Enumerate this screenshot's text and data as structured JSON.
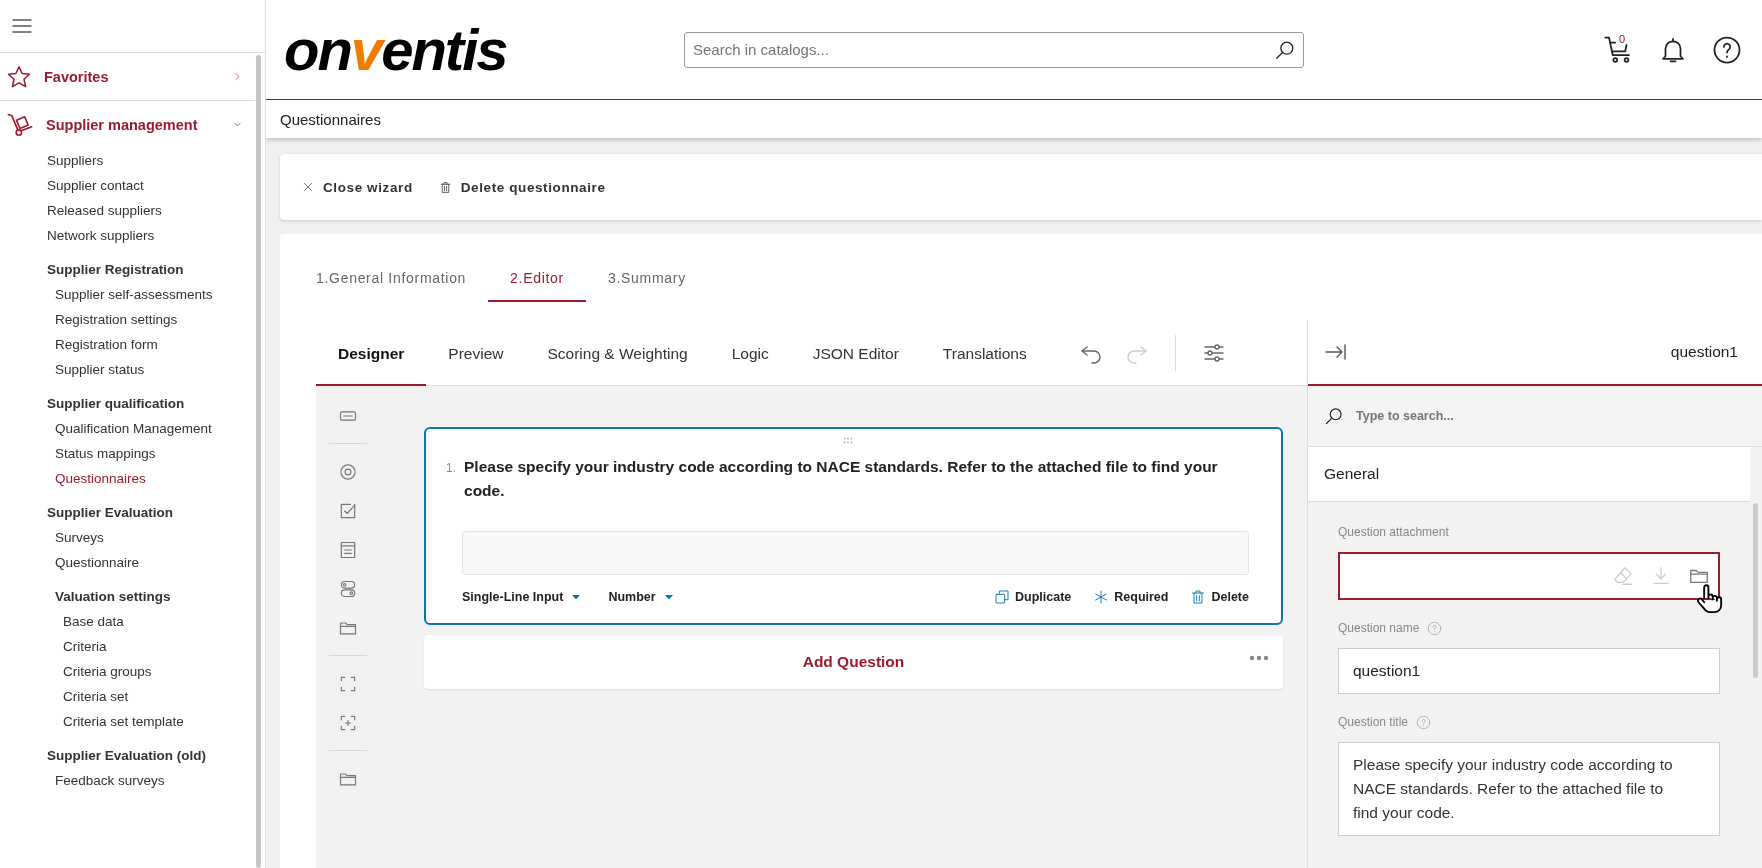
{
  "sidebar": {
    "items": [
      {
        "kind": "top",
        "label": "Favorites",
        "expanded": false
      },
      {
        "kind": "top",
        "label": "Supplier management",
        "expanded": true,
        "children": [
          {
            "kind": "link",
            "label": "Suppliers",
            "selected": false
          },
          {
            "kind": "link",
            "label": "Supplier contact",
            "selected": false
          },
          {
            "kind": "link",
            "label": "Released suppliers",
            "selected": false
          },
          {
            "kind": "link",
            "label": "Network suppliers",
            "selected": false
          },
          {
            "kind": "heading",
            "label": "Supplier Registration",
            "children": [
              {
                "kind": "link",
                "label": "Supplier self-assessments",
                "selected": false
              },
              {
                "kind": "link",
                "label": "Registration settings",
                "selected": false
              },
              {
                "kind": "link",
                "label": "Registration form",
                "selected": false
              },
              {
                "kind": "link",
                "label": "Supplier status",
                "selected": false
              }
            ]
          },
          {
            "kind": "heading",
            "label": "Supplier qualification",
            "children": [
              {
                "kind": "link",
                "label": "Qualification Management",
                "selected": false
              },
              {
                "kind": "link",
                "label": "Status mappings",
                "selected": false
              },
              {
                "kind": "link",
                "label": "Questionnaires",
                "selected": true
              }
            ]
          },
          {
            "kind": "heading",
            "label": "Supplier Evaluation",
            "children": [
              {
                "kind": "link",
                "label": "Surveys",
                "selected": false
              },
              {
                "kind": "link",
                "label": "Questionnaire",
                "selected": false
              },
              {
                "kind": "heading",
                "label": "Valuation settings",
                "children": [
                  {
                    "kind": "link",
                    "label": "Base data",
                    "selected": false
                  },
                  {
                    "kind": "link",
                    "label": "Criteria",
                    "selected": false
                  },
                  {
                    "kind": "link",
                    "label": "Criteria groups",
                    "selected": false
                  },
                  {
                    "kind": "link",
                    "label": "Criteria set",
                    "selected": false
                  },
                  {
                    "kind": "link",
                    "label": "Criteria set template",
                    "selected": false
                  }
                ]
              }
            ]
          },
          {
            "kind": "heading",
            "label": "Supplier Evaluation (old)",
            "children": [
              {
                "kind": "link",
                "label": "Feedback surveys",
                "selected": false
              }
            ]
          }
        ]
      }
    ]
  },
  "header": {
    "logo": [
      {
        "text": "on",
        "accent": false
      },
      {
        "text": "v",
        "accent": true
      },
      {
        "text": "entis",
        "accent": false
      }
    ],
    "search": {
      "placeholder": "Search in catalogs..."
    },
    "cart_count": "0"
  },
  "breadcrumb": "Questionnaires",
  "toolbar": {
    "buttons": [
      "Close wizard",
      "Delete questionnaire"
    ]
  },
  "steps": [
    {
      "label": "1.General Information",
      "selected": false
    },
    {
      "label": "2.Editor",
      "selected": true
    },
    {
      "label": "3.Summary",
      "selected": false
    }
  ],
  "editor_tabs": [
    {
      "label": "Designer",
      "selected": true
    },
    {
      "label": "Preview",
      "selected": false
    },
    {
      "label": "Scoring & Weighting",
      "selected": false
    },
    {
      "label": "Logic",
      "selected": false
    },
    {
      "label": "JSON Editor",
      "selected": false
    },
    {
      "label": "Translations",
      "selected": false
    }
  ],
  "history": [
    {
      "disabled": false
    },
    {
      "disabled": true
    }
  ],
  "question": {
    "number": "1.",
    "title": "Please specify your industry code according to NACE standards. Refer to the attached file to find your code.",
    "selected": true,
    "type": "Single-Line Input",
    "format": "Number",
    "actions": [
      "Duplicate",
      "Required",
      "Delete"
    ]
  },
  "add_question": "Add Question",
  "properties": {
    "title": "question1",
    "search": {
      "placeholder": "Type to search..."
    },
    "section": "General",
    "fields": [
      {
        "kind": "attachment",
        "label": "Question attachment",
        "help": false,
        "focused": true
      },
      {
        "kind": "text",
        "label": "Question name",
        "help": true,
        "value": "question1"
      },
      {
        "kind": "textarea",
        "label": "Question title",
        "help": true,
        "value": "Please specify your industry code according to NACE standards. Refer to the attached file to find your code."
      }
    ]
  }
}
